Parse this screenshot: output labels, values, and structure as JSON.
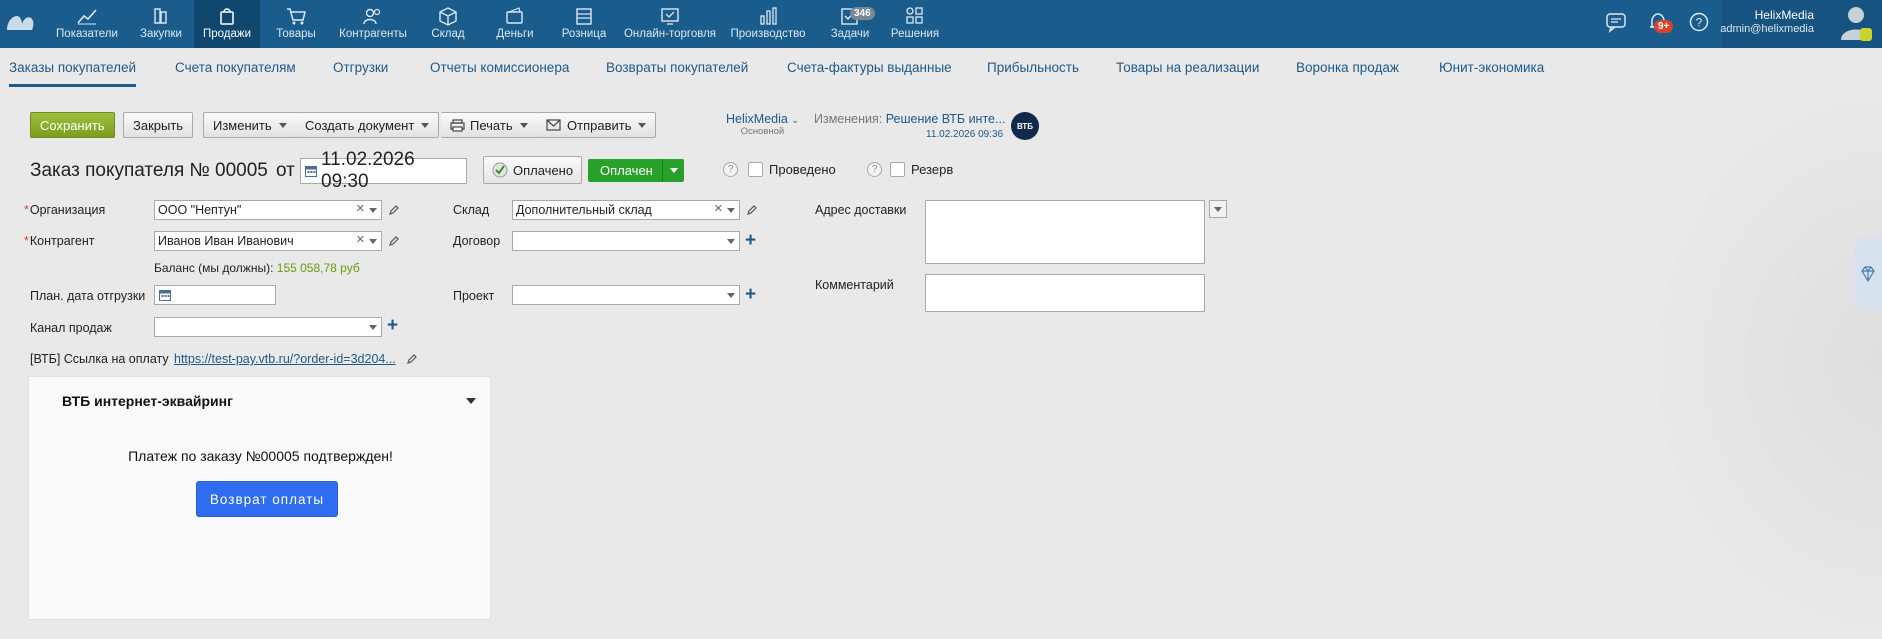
{
  "topnav": {
    "items": [
      {
        "label": "Показатели",
        "icon": "chart-line-icon"
      },
      {
        "label": "Закупки",
        "icon": "purchases-icon"
      },
      {
        "label": "Продажи",
        "icon": "shopping-bag-icon",
        "active": true
      },
      {
        "label": "Товары",
        "icon": "cart-icon"
      },
      {
        "label": "Контрагенты",
        "icon": "users-icon"
      },
      {
        "label": "Склад",
        "icon": "box-icon"
      },
      {
        "label": "Деньги",
        "icon": "wallet-icon"
      },
      {
        "label": "Розница",
        "icon": "store-icon"
      },
      {
        "label": "Онлайн-торговля",
        "icon": "online-store-icon"
      },
      {
        "label": "Производство",
        "icon": "production-icon"
      },
      {
        "label": "Задачи",
        "icon": "tasks-icon",
        "badge": "346"
      },
      {
        "label": "Решения",
        "icon": "grid-icon"
      }
    ],
    "notifications_badge": "9+",
    "user": {
      "name": "HelixMedia",
      "email": "admin@helixmedia"
    }
  },
  "subnav": {
    "tabs": [
      "Заказы покупателей",
      "Счета покупателям",
      "Отгрузки",
      "Отчеты комиссионера",
      "Возвраты покупателей",
      "Счета-фактуры выданные",
      "Прибыльность",
      "Товары на реализации",
      "Воронка продаж",
      "Юнит-экономика"
    ]
  },
  "toolbar": {
    "save": "Сохранить",
    "close": "Закрыть",
    "edit": "Изменить",
    "create_doc": "Создать документ",
    "print": "Печать",
    "send": "Отправить",
    "account_name": "HelixMedia",
    "account_sub": "Основной",
    "changes_prefix": "Изменения:",
    "changes_link": "Решение ВТБ инте...",
    "changes_date": "11.02.2026 09:36",
    "vtb_logo": "ВТБ"
  },
  "header": {
    "title": "Заказ покупателя №",
    "number": "00005",
    "from": "от",
    "date": "11.02.2026 09:30",
    "paid_button": "Оплачено",
    "status": "Оплачен",
    "posted_label": "Проведено",
    "reserve_label": "Резерв",
    "help": "?"
  },
  "form": {
    "organization_label": "Организация",
    "organization_value": "ООО \"Нептун\"",
    "counterparty_label": "Контрагент",
    "counterparty_value": "Иванов Иван Иванович",
    "balance_label": "Баланс (мы должны):",
    "balance_value": "155 058,78 руб",
    "ship_date_label": "План. дата отгрузки",
    "channel_label": "Канал продаж",
    "warehouse_label": "Склад",
    "warehouse_value": "Дополнительный склад",
    "contract_label": "Договор",
    "project_label": "Проект",
    "address_label": "Адрес доставки",
    "comment_label": "Комментарий",
    "pay_link_label": "[ВТБ] Ссылка на оплату",
    "pay_link_value": "https://test-pay.vtb.ru/?order-id=3d204..."
  },
  "vtb_panel": {
    "title": "ВТБ интернет-эквайринг",
    "message": "Платеж по заказу №00005 подтвержден!",
    "refund_button": "Возврат оплаты"
  },
  "colors": {
    "topbar": "#1a5d8c",
    "link": "#1d5a8a",
    "save": "#8aad2b",
    "status_green": "#27a12a",
    "refund_blue": "#2f6df0"
  }
}
